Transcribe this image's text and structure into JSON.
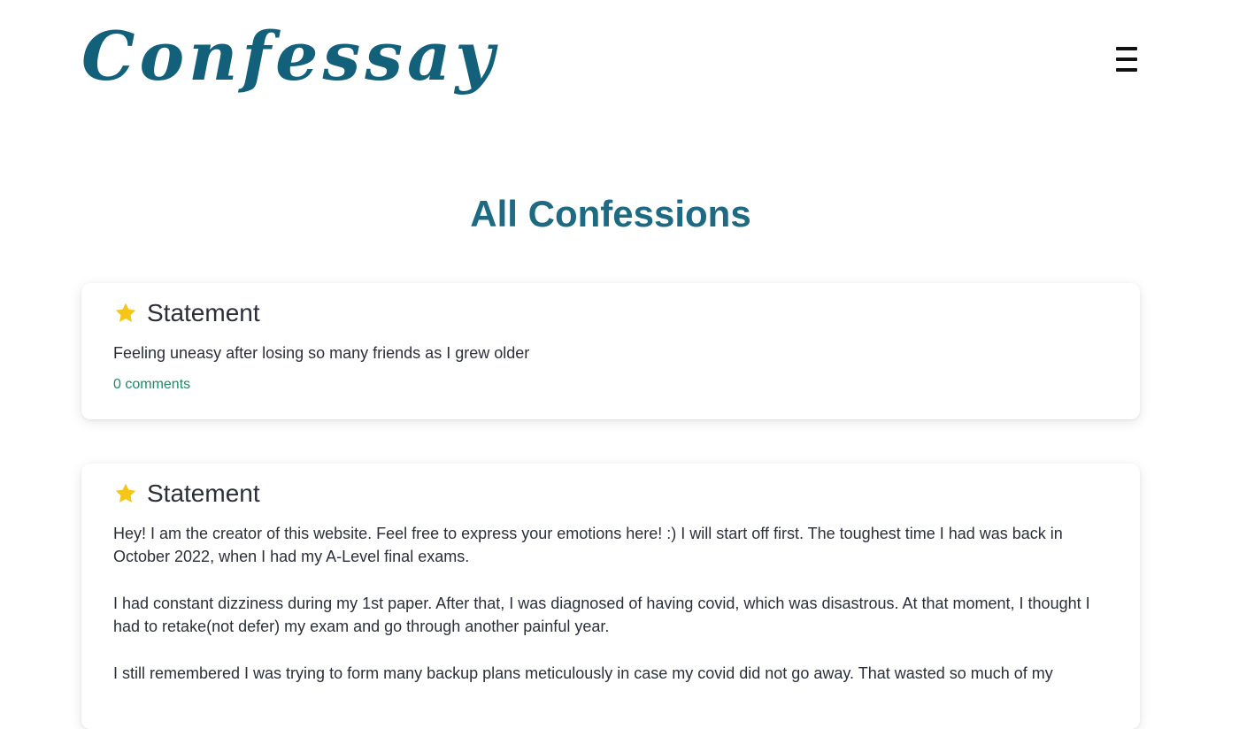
{
  "header": {
    "logo_text": "Confessay",
    "menu_icon": "hamburger-menu-icon"
  },
  "main": {
    "title": "All Confessions"
  },
  "confessions": [
    {
      "icon": "star-icon",
      "type": "Statement",
      "paragraphs": [
        "Feeling uneasy after losing so many friends as I grew older"
      ],
      "comments_label": "0 comments"
    },
    {
      "icon": "star-icon",
      "type": "Statement",
      "paragraphs": [
        "Hey! I am the creator of this website. Feel free to express your emotions here! :) I will start off first. The toughest time I had was back in October 2022, when I had my A-Level final exams.",
        "I had constant dizziness during my 1st paper. After that, I was diagnosed of having covid, which was disastrous. At that moment, I thought I had to retake(not defer) my exam and go through another painful year.",
        "I still remembered I was trying to form many backup plans meticulously in case my covid did not go away. That wasted so much of my"
      ]
    }
  ],
  "colors": {
    "brand": "#12607a",
    "title": "#1d6a82",
    "star": "#f5c518",
    "comments_link": "#1f8a63",
    "text": "#2c2f3a"
  }
}
